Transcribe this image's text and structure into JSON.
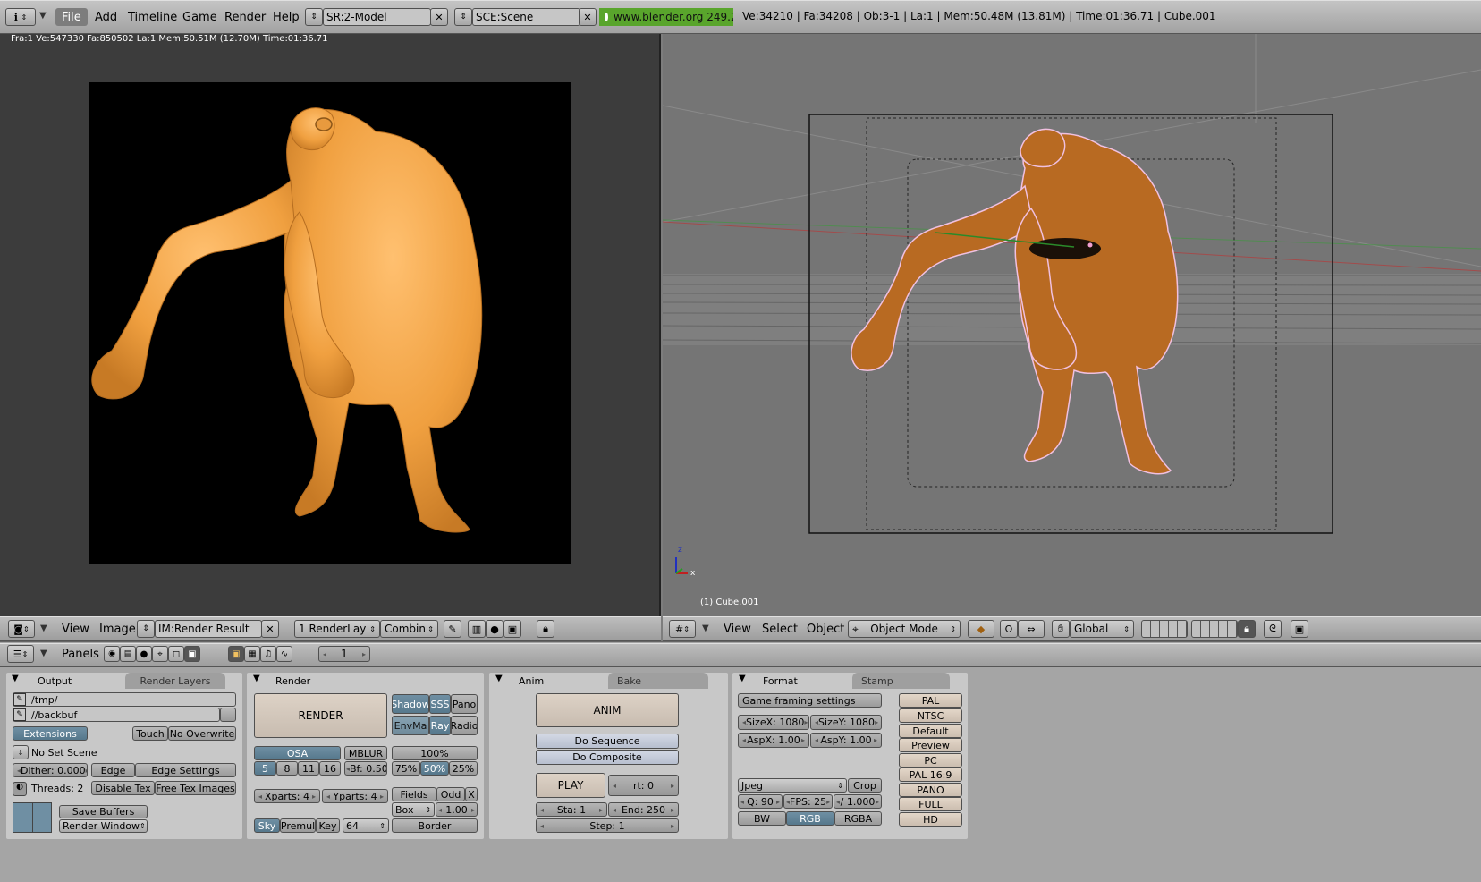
{
  "topbar": {
    "menus": [
      "File",
      "Add",
      "Timeline",
      "Game",
      "Render",
      "Help"
    ],
    "screen": "SR:2-Model",
    "scene": "SCE:Scene",
    "site": "www.blender.org 249.2",
    "stats": "Ve:34210 | Fa:34208 | Ob:3-1 | La:1  | Mem:50.48M (13.81M)  | Time:01:36.71 | Cube.001"
  },
  "render_window": {
    "info": "Fra:1  Ve:547330 Fa:850502 La:1 Mem:50.51M (12.70M) Time:01:36.71"
  },
  "image_header": {
    "menus": [
      "View",
      "Image"
    ],
    "image": "IM:Render Result",
    "layer": "1 RenderLay",
    "pass": "Combin"
  },
  "viewport": {
    "object_label": "(1) Cube.001",
    "axis_z": "z",
    "axis_x": "x"
  },
  "view3d_header": {
    "menus": [
      "View",
      "Select",
      "Object"
    ],
    "mode": "Object Mode",
    "orientation": "Global"
  },
  "buttons_header": {
    "panels_label": "Panels",
    "frame": "1"
  },
  "output_panel": {
    "tabs": [
      "Output",
      "Render Layers"
    ],
    "path1": "/tmp/",
    "path2": "//backbuf",
    "extensions": "Extensions",
    "touch": "Touch",
    "no_overwrite": "No Overwrite",
    "no_set_scene": "No Set Scene",
    "dither": "Dither: 0.000",
    "edge": "Edge",
    "edge_settings": "Edge Settings",
    "threads": "Threads: 2",
    "disable_tex": "Disable Tex",
    "free_tex": "Free Tex Images",
    "save_buffers": "Save Buffers",
    "render_window": "Render Window"
  },
  "render_panel": {
    "title": "Render",
    "render": "RENDER",
    "shadow": "Shadow",
    "sss": "SSS",
    "pano": "Pano",
    "envma": "EnvMa",
    "ray": "Ray",
    "radio": "Radio",
    "osa": "OSA",
    "osa_vals": [
      "5",
      "8",
      "11",
      "16"
    ],
    "mblur": "MBLUR",
    "bf": "Bf: 0.50",
    "pct100": "100%",
    "pcts": [
      "75%",
      "50%",
      "25%"
    ],
    "xparts": "Xparts: 4",
    "yparts": "Yparts: 4",
    "fields": "Fields",
    "odd": "Odd",
    "x": "X",
    "box": "Box",
    "filter": "1.00",
    "sky": "Sky",
    "premul": "Premul",
    "key": "Key",
    "bits": "64",
    "border": "Border"
  },
  "anim_panel": {
    "tabs": [
      "Anim",
      "Bake"
    ],
    "anim": "ANIM",
    "do_sequence": "Do Sequence",
    "do_composite": "Do Composite",
    "play": "PLAY",
    "rt": "rt: 0",
    "sta": "Sta: 1",
    "end": "End: 250",
    "step": "Step: 1"
  },
  "format_panel": {
    "tabs": [
      "Format",
      "Stamp"
    ],
    "game_framing": "Game framing settings",
    "sizex": "SizeX: 1080",
    "sizey": "SizeY: 1080",
    "aspx": "AspX: 1.00",
    "aspy": "AspY: 1.00",
    "format": "Jpeg",
    "crop": "Crop",
    "q": "Q: 90",
    "fps": "FPS: 25",
    "fps_base": "/ 1.000",
    "bw": "BW",
    "rgb": "RGB",
    "rgba": "RGBA",
    "presets": [
      "PAL",
      "NTSC",
      "Default",
      "Preview",
      "PC",
      "PAL 16:9",
      "PANO",
      "FULL",
      "HD"
    ]
  },
  "colors": {
    "model_render": "#f0a040",
    "model_viewport": "#b86a22",
    "site_green": "#59a52c",
    "active_blue": "#5d7f94"
  }
}
